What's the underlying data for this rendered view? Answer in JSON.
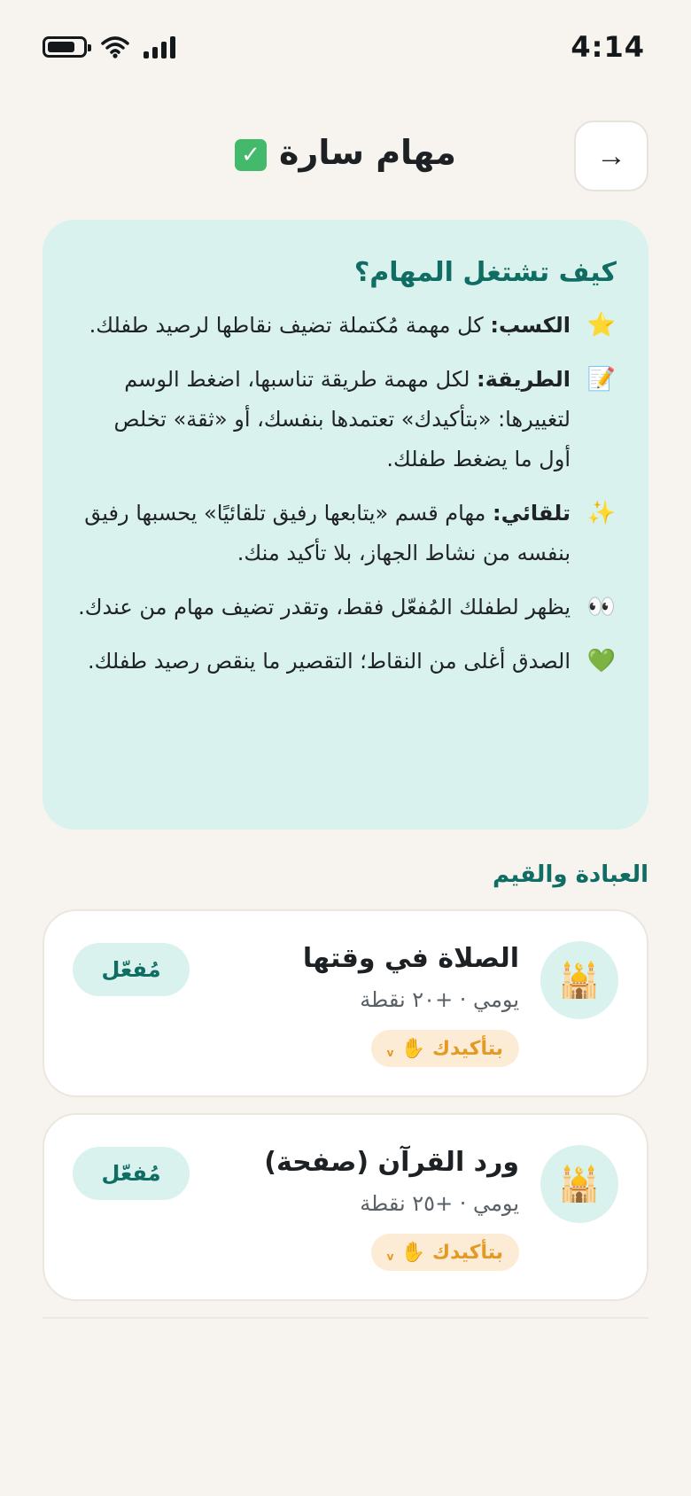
{
  "status_bar": {
    "time": "4:14"
  },
  "header": {
    "title": "مهام سارة",
    "back_arrow": "→",
    "check_glyph": "✓"
  },
  "info": {
    "title": "كيف تشتغل المهام؟",
    "items": [
      {
        "icon": "⭐",
        "icon_name": "star-icon",
        "lead": "الكسب:",
        "text": " كل مهمة مُكتملة تضيف نقاطها لرصيد طفلك."
      },
      {
        "icon": "📝",
        "icon_name": "memo-icon",
        "lead": "الطريقة:",
        "text": " لكل مهمة طريقة تناسبها، اضغط الوسم لتغييرها: «بتأكيدك» تعتمدها بنفسك، أو «ثقة» تخلص أول ما يضغط طفلك."
      },
      {
        "icon": "✨",
        "icon_name": "sparkles-icon",
        "lead": "تلقائي:",
        "text": " مهام قسم «يتابعها رفيق تلقائيًا» يحسبها رفيق بنفسه من نشاط الجهاز، بلا تأكيد منك."
      },
      {
        "icon": "👀",
        "icon_name": "eyes-icon",
        "lead": "",
        "text": "يظهر لطفلك المُفعّل فقط، وتقدر تضيف مهام من عندك."
      },
      {
        "icon": "💚",
        "icon_name": "green-heart-icon",
        "lead": "",
        "text": "الصدق أغلى من النقاط؛ التقصير ما ينقص رصيد طفلك."
      }
    ]
  },
  "section": {
    "title": "العبادة والقيم"
  },
  "tasks": [
    {
      "name": "الصلاة في وقتها",
      "meta": "يومي · +٢٠ نقطة",
      "method": "بتأكيدك",
      "method_icon": "✋",
      "chevron": "v",
      "status": "مُفعّل",
      "icon": "🕌"
    },
    {
      "name": "ورد القرآن (صفحة)",
      "meta": "يومي · +٢٥ نقطة",
      "method": "بتأكيدك",
      "method_icon": "✋",
      "chevron": "v",
      "status": "مُفعّل",
      "icon": "🕌"
    }
  ]
}
